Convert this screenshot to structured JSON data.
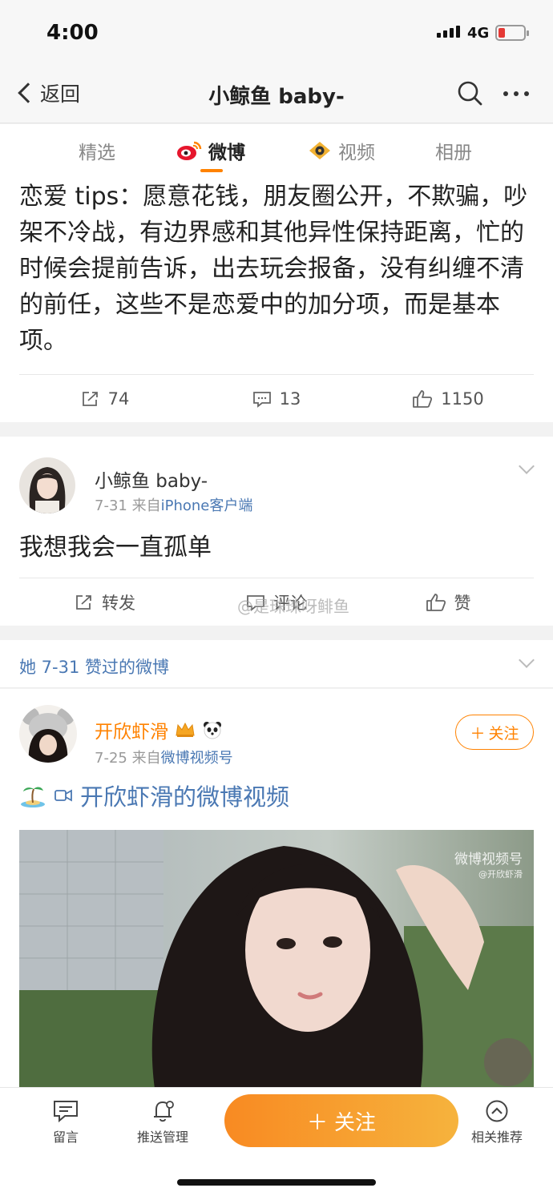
{
  "status": {
    "time": "4:00",
    "network": "4G"
  },
  "nav": {
    "back_label": "返回",
    "title": "小鲸鱼 baby-"
  },
  "tabs": [
    {
      "label": "精选"
    },
    {
      "label": "微博"
    },
    {
      "label": "视频"
    },
    {
      "label": "相册"
    }
  ],
  "post1": {
    "text": "恋爱 tips：愿意花钱，朋友圈公开，不欺骗，吵架不冷战，有边界感和其他异性保持距离，忙的时候会提前告诉，出去玩会报备，没有纠缠不清的前任，这些不是恋爱中的加分项，而是基本项。",
    "reposts": "74",
    "comments": "13",
    "likes": "1150"
  },
  "post2": {
    "author": "小鲸鱼 baby-",
    "date": "7-31",
    "from_prefix": "来自",
    "source": "iPhone客户端",
    "text": "我想我会一直孤单",
    "repost_label": "转发",
    "comment_label": "评论",
    "like_label": "赞",
    "watermark": "@是珠珠呀鲱鱼"
  },
  "liked_header": {
    "label": "她 7-31 赞过的微博"
  },
  "post3": {
    "author": "开欣虾滑",
    "date": "7-25",
    "from_prefix": "来自",
    "source": "微博视频号",
    "follow_label": "关注",
    "video_title": "开欣虾滑的微博视频",
    "video_watermark": "微博视频号",
    "video_watermark_sub": "@开欣虾滑"
  },
  "bottom": {
    "message_label": "留言",
    "push_label": "推送管理",
    "follow_label": "关注",
    "recommend_label": "相关推荐"
  },
  "colors": {
    "accent": "#ff8200",
    "link": "#4a78b3"
  }
}
